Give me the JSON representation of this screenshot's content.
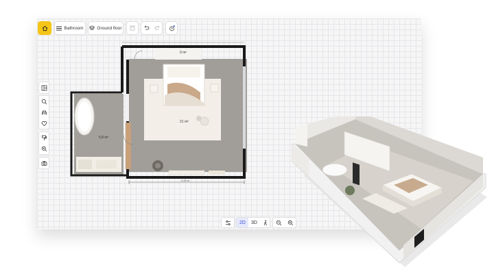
{
  "toolbar": {
    "home_icon": "home-icon",
    "room_label": "Bathroom",
    "floor_label": "Ground floor",
    "accent": "#f5c518"
  },
  "plan": {
    "bedroom_area": "21 m²",
    "bathroom_area": "5.8 m²",
    "top_area": "0 m²",
    "dimension": "4.00 m"
  },
  "viewbar": {
    "mode_2d": "2D",
    "mode_3d": "3D"
  }
}
